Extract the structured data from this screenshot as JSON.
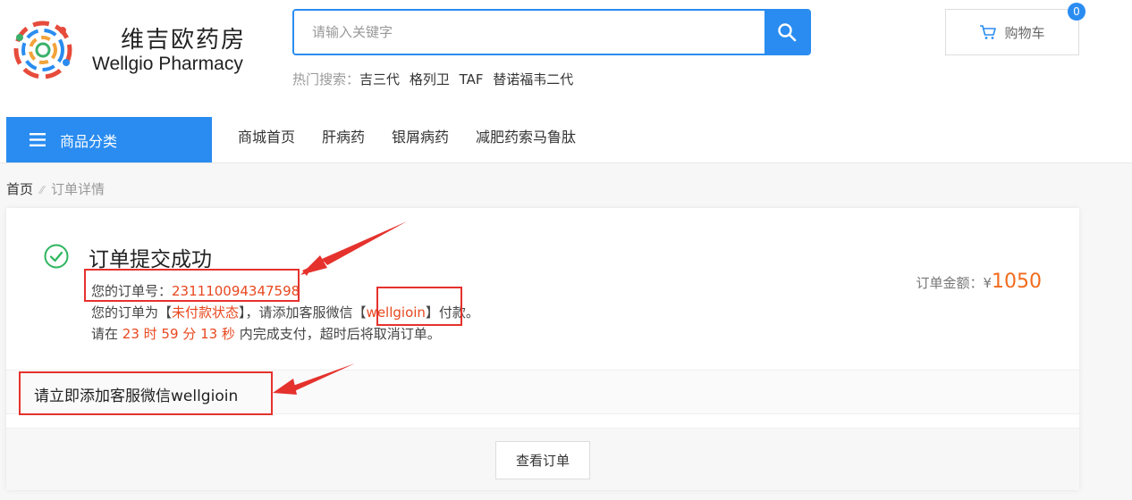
{
  "brand": {
    "name_cn": "维吉欧药房",
    "name_en": "Wellgio Pharmacy"
  },
  "search": {
    "placeholder": "请输入关键字"
  },
  "hot_search": {
    "label": "热门搜索：",
    "items": [
      "吉三代",
      "格列卫",
      "TAF",
      "替诺福韦二代"
    ]
  },
  "cart": {
    "label": "购物车",
    "count": "0"
  },
  "category": {
    "label": "商品分类"
  },
  "nav": {
    "items": [
      "商城首页",
      "肝病药",
      "银屑病药",
      "减肥药索马鲁肽"
    ]
  },
  "breadcrumb": {
    "home": "首页",
    "separator": "⁄⁄",
    "current": "订单详情"
  },
  "order": {
    "title": "订单提交成功",
    "number_label": "您的订单号：",
    "number": "231110094347598",
    "status_prefix": "您的订单为【",
    "status": "未付款状态",
    "status_mid": "】，请添加客服微信【",
    "wechat": "wellgioin",
    "status_suffix": "】付款。",
    "deadline_prefix": "请在 ",
    "deadline_h": "23",
    "deadline_h_unit": " 时 ",
    "deadline_m": "59",
    "deadline_m_unit": " 分 ",
    "deadline_s": "13",
    "deadline_s_unit": " 秒",
    "deadline_suffix": " 内完成支付，超时后将取消订单。",
    "amount_label": "订单金额：¥",
    "amount": "1050",
    "notice": "请立即添加客服微信wellgioin",
    "view_button": "查看订单"
  },
  "colors": {
    "accent": "#2a8cf0",
    "highlight": "#e8481f",
    "amount": "#f26b1d",
    "annotation": "#e5322d",
    "success": "#2db55d"
  },
  "icons": [
    "search-icon",
    "cart-icon",
    "menu-icon",
    "success-check-icon",
    "logo-icon"
  ]
}
